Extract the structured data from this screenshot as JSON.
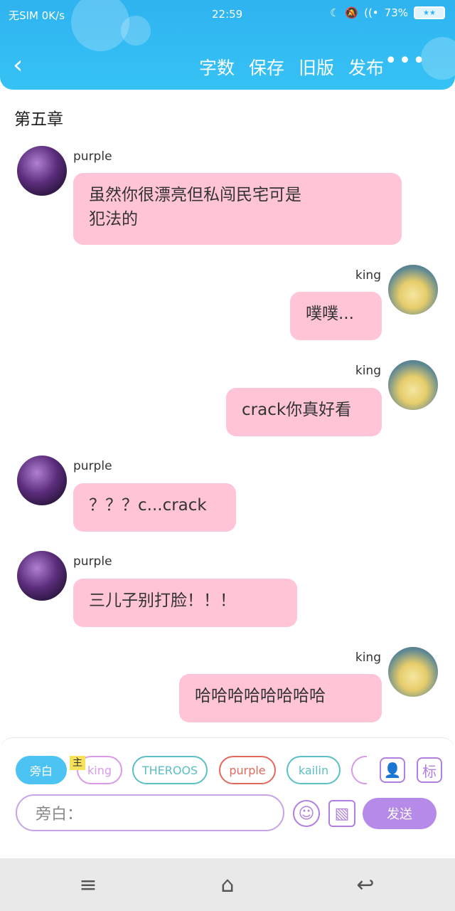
{
  "status_bar": {
    "carrier": "无SIM 0K/s",
    "time": "22:59",
    "battery_text": "73%"
  },
  "nav": {
    "back_icon": "back-chevron-icon",
    "actions": [
      "字数",
      "保存",
      "旧版",
      "发布"
    ],
    "more": "•••"
  },
  "chapter": {
    "title": "第五章"
  },
  "messages": [
    {
      "side": "left",
      "user": "purple",
      "text_lines": [
        "虽然你很漂亮但私闯民宅可是",
        "犯法的"
      ]
    },
    {
      "side": "right",
      "user": "king",
      "text_lines": [
        "噗噗..."
      ]
    },
    {
      "side": "right",
      "user": "king",
      "text_lines": [
        "crack你真好看"
      ]
    },
    {
      "side": "left",
      "user": "purple",
      "text_lines": [
        "？？？c...crack"
      ]
    },
    {
      "side": "left",
      "user": "purple",
      "text_lines": [
        "三儿子别打脸！！！"
      ]
    },
    {
      "side": "right",
      "user": "king",
      "text_lines": [
        "哈哈哈哈哈哈哈哈"
      ]
    }
  ],
  "composer": {
    "roles": [
      {
        "label": "旁白",
        "selected": true,
        "color": "#4cc3f2"
      },
      {
        "label": "king",
        "color": "#d99ae8"
      },
      {
        "label": "THEROOS",
        "color": "#5bbfc6"
      },
      {
        "label": "purple",
        "color": "#e0695c"
      },
      {
        "label": "kailin",
        "color": "#5bbfc6"
      },
      {
        "label": "",
        "color": "#d99ae8"
      }
    ],
    "main_tag": "主",
    "icon_contact": "contact-card-icon",
    "icon_tag": "标",
    "input_placeholder": "旁白：",
    "emoji_icon": "emoji-icon",
    "image_icon": "image-icon",
    "send_label": "发送"
  },
  "system_nav": {
    "menu_icon": "menu-icon",
    "home_icon": "home-icon",
    "back_icon": "back-icon"
  }
}
